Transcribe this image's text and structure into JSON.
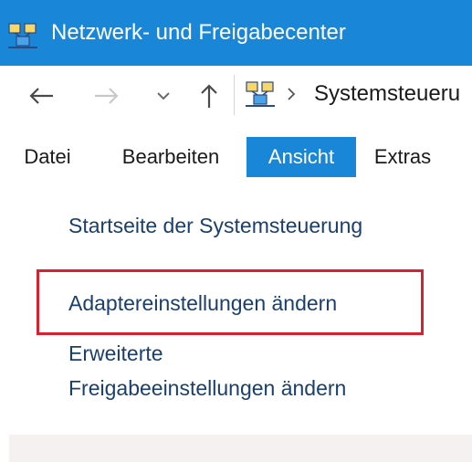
{
  "window": {
    "title": "Netzwerk- und Freigabecenter",
    "title_icon": "network-icon",
    "accent_color": "#1a86d8"
  },
  "navigation": {
    "back_icon": "arrow-left-icon",
    "forward_icon": "arrow-right-icon",
    "recent_icon": "chevron-down-icon",
    "up_icon": "arrow-up-icon",
    "address_icon": "network-icon",
    "separator_icon": "chevron-right-icon",
    "address_text": "Systemsteueru"
  },
  "menu": {
    "items": [
      {
        "label": "Datei"
      },
      {
        "label": "Bearbeiten"
      },
      {
        "label": "Ansicht",
        "active": true
      },
      {
        "label": "Extras"
      }
    ]
  },
  "sidebar": {
    "links": [
      {
        "label": "Startseite der Systemsteuerung"
      },
      {
        "label": "Adaptereinstellungen ändern",
        "highlighted": true,
        "highlight_color": "#d62230"
      },
      {
        "label_line1": "Erweiterte",
        "label_line2": "Freigabeeinstellungen ändern"
      }
    ]
  }
}
